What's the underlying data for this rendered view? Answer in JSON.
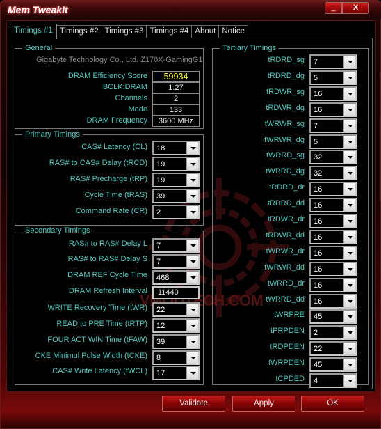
{
  "window": {
    "title": "Mem TweakIt",
    "minimize_label": "_",
    "close_label": "X"
  },
  "tabs": [
    {
      "label": "Timings #1",
      "active": true
    },
    {
      "label": "Timings #2",
      "active": false
    },
    {
      "label": "Timings #3",
      "active": false
    },
    {
      "label": "Timings #4",
      "active": false
    },
    {
      "label": "About",
      "active": false
    },
    {
      "label": "Notice",
      "active": false
    }
  ],
  "watermark": "VMODTECH.COM",
  "general": {
    "title": "General",
    "board": "Gigabyte Technology Co., Ltd. Z170X-GamingG1",
    "rows": [
      {
        "label": "DRAM Efficiency Score",
        "value": "59934"
      },
      {
        "label": "BCLK:DRAM",
        "value": "1:27"
      },
      {
        "label": "Channels",
        "value": "2"
      },
      {
        "label": "Mode",
        "value": "133"
      },
      {
        "label": "DRAM Frequency",
        "value": "3600 MHz"
      }
    ]
  },
  "primary": {
    "title": "Primary Timings",
    "rows": [
      {
        "label": "CAS# Latency (CL)",
        "value": "18"
      },
      {
        "label": "RAS# to CAS# Delay (tRCD)",
        "value": "19"
      },
      {
        "label": "RAS# Precharge (tRP)",
        "value": "19"
      },
      {
        "label": "Cycle Time (tRAS)",
        "value": "39"
      },
      {
        "label": "Command Rate (CR)",
        "value": "2"
      }
    ]
  },
  "secondary": {
    "title": "Secondary Timings",
    "rows": [
      {
        "label": "RAS# to RAS# Delay L",
        "value": "7"
      },
      {
        "label": "RAS# to RAS# Delay S",
        "value": "7"
      },
      {
        "label": "DRAM REF Cycle Time",
        "value": "468"
      },
      {
        "label": "DRAM Refresh Interval",
        "value": "11440"
      },
      {
        "label": "WRITE Recovery Time (tWR)",
        "value": "22"
      },
      {
        "label": "READ to PRE Time (tRTP)",
        "value": "12"
      },
      {
        "label": "FOUR ACT WIN Time (tFAW)",
        "value": "39"
      },
      {
        "label": "CKE Minimul Pulse Width (tCKE)",
        "value": "8"
      },
      {
        "label": "CAS# Write Latency (tWCL)",
        "value": "17"
      }
    ]
  },
  "tertiary": {
    "title": "Tertiary Timings",
    "rows": [
      {
        "label": "tRDRD_sg",
        "value": "7"
      },
      {
        "label": "tRDRD_dg",
        "value": "5"
      },
      {
        "label": "tRDWR_sg",
        "value": "16"
      },
      {
        "label": "tRDWR_dg",
        "value": "16"
      },
      {
        "label": "tWRWR_sg",
        "value": "7"
      },
      {
        "label": "tWRWR_dg",
        "value": "5"
      },
      {
        "label": "tWRRD_sg",
        "value": "32"
      },
      {
        "label": "tWRRD_dg",
        "value": "32"
      },
      {
        "label": "tRDRD_dr",
        "value": "16"
      },
      {
        "label": "tRDRD_dd",
        "value": "16"
      },
      {
        "label": "tRDWR_dr",
        "value": "16"
      },
      {
        "label": "tRDWR_dd",
        "value": "16"
      },
      {
        "label": "tWRWR_dr",
        "value": "16"
      },
      {
        "label": "tWRWR_dd",
        "value": "16"
      },
      {
        "label": "tWRRD_dr",
        "value": "16"
      },
      {
        "label": "tWRRD_dd",
        "value": "16"
      },
      {
        "label": "tWRPRE",
        "value": "45"
      },
      {
        "label": "tPRPDEN",
        "value": "2"
      },
      {
        "label": "tRDPDEN",
        "value": "22"
      },
      {
        "label": "tWRPDEN",
        "value": "45"
      },
      {
        "label": "tCPDED",
        "value": "4"
      }
    ]
  },
  "footer": {
    "validate_label": "Validate",
    "apply_label": "Apply",
    "ok_label": "OK"
  }
}
